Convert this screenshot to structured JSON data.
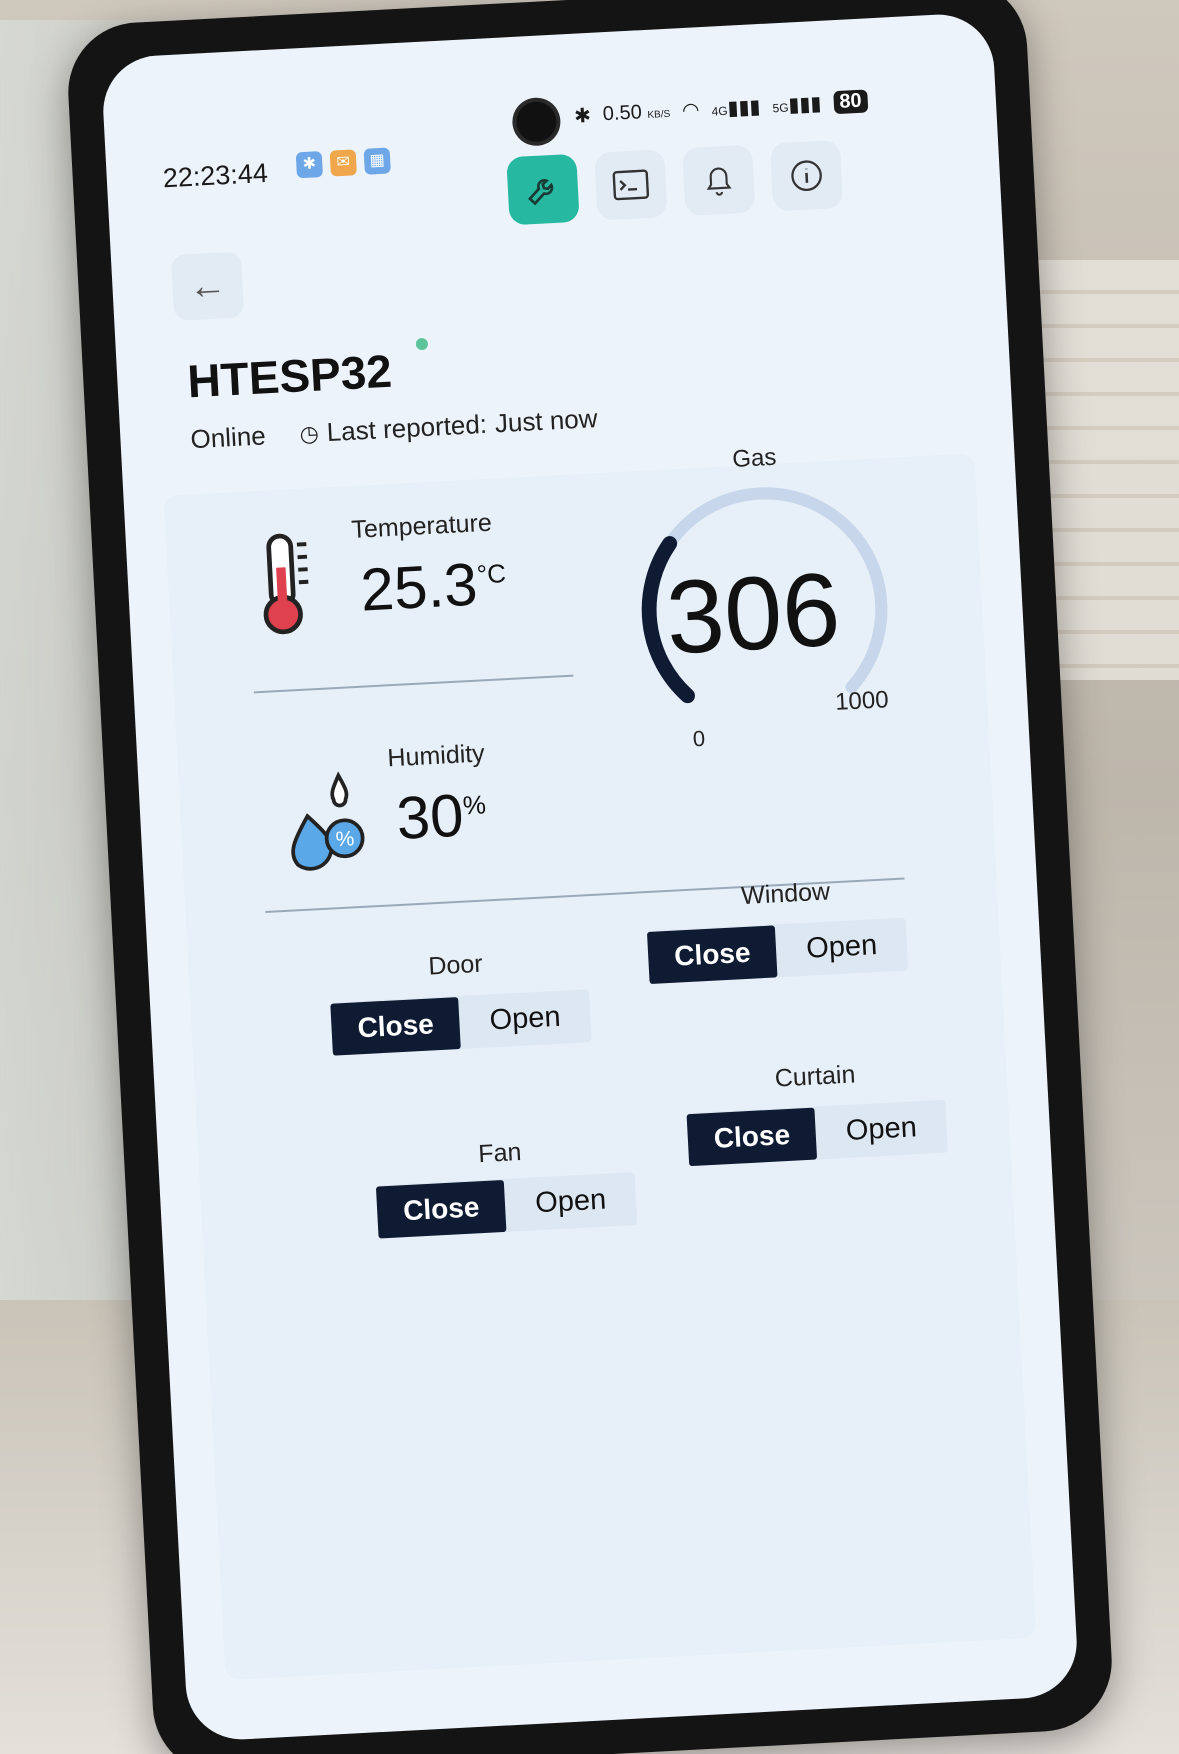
{
  "status_bar": {
    "time": "22:23:44",
    "net_speed": "0.50",
    "net_unit": "KB/S",
    "signal_1": "4G",
    "signal_2": "5G",
    "battery": "80"
  },
  "toolbar": {
    "items": [
      {
        "icon": "wrench-icon",
        "active": true
      },
      {
        "icon": "terminal-icon",
        "active": false
      },
      {
        "icon": "bell-icon",
        "active": false
      },
      {
        "icon": "info-icon",
        "active": false
      }
    ]
  },
  "header": {
    "title": "HTESP32",
    "status": "Online",
    "last_reported_label": "Last reported:",
    "last_reported_value": "Just now",
    "status_color": "#5bc49a"
  },
  "sensors": {
    "temperature": {
      "label": "Temperature",
      "value": "25.3",
      "unit": "°C"
    },
    "humidity": {
      "label": "Humidity",
      "value": "30",
      "unit": "%"
    },
    "gas": {
      "label": "Gas",
      "value": "306",
      "min": "0",
      "max": "1000",
      "fraction": 0.306
    }
  },
  "controls": [
    {
      "name": "Door",
      "close": "Close",
      "open": "Open"
    },
    {
      "name": "Window",
      "close": "Close",
      "open": "Open"
    },
    {
      "name": "Fan",
      "close": "Close",
      "open": "Open"
    },
    {
      "name": "Curtain",
      "close": "Close",
      "open": "Open"
    }
  ],
  "colors": {
    "accent": "#26b8a0",
    "button_dark": "#0f1b33",
    "screen_bg": "#ecf3fb"
  }
}
